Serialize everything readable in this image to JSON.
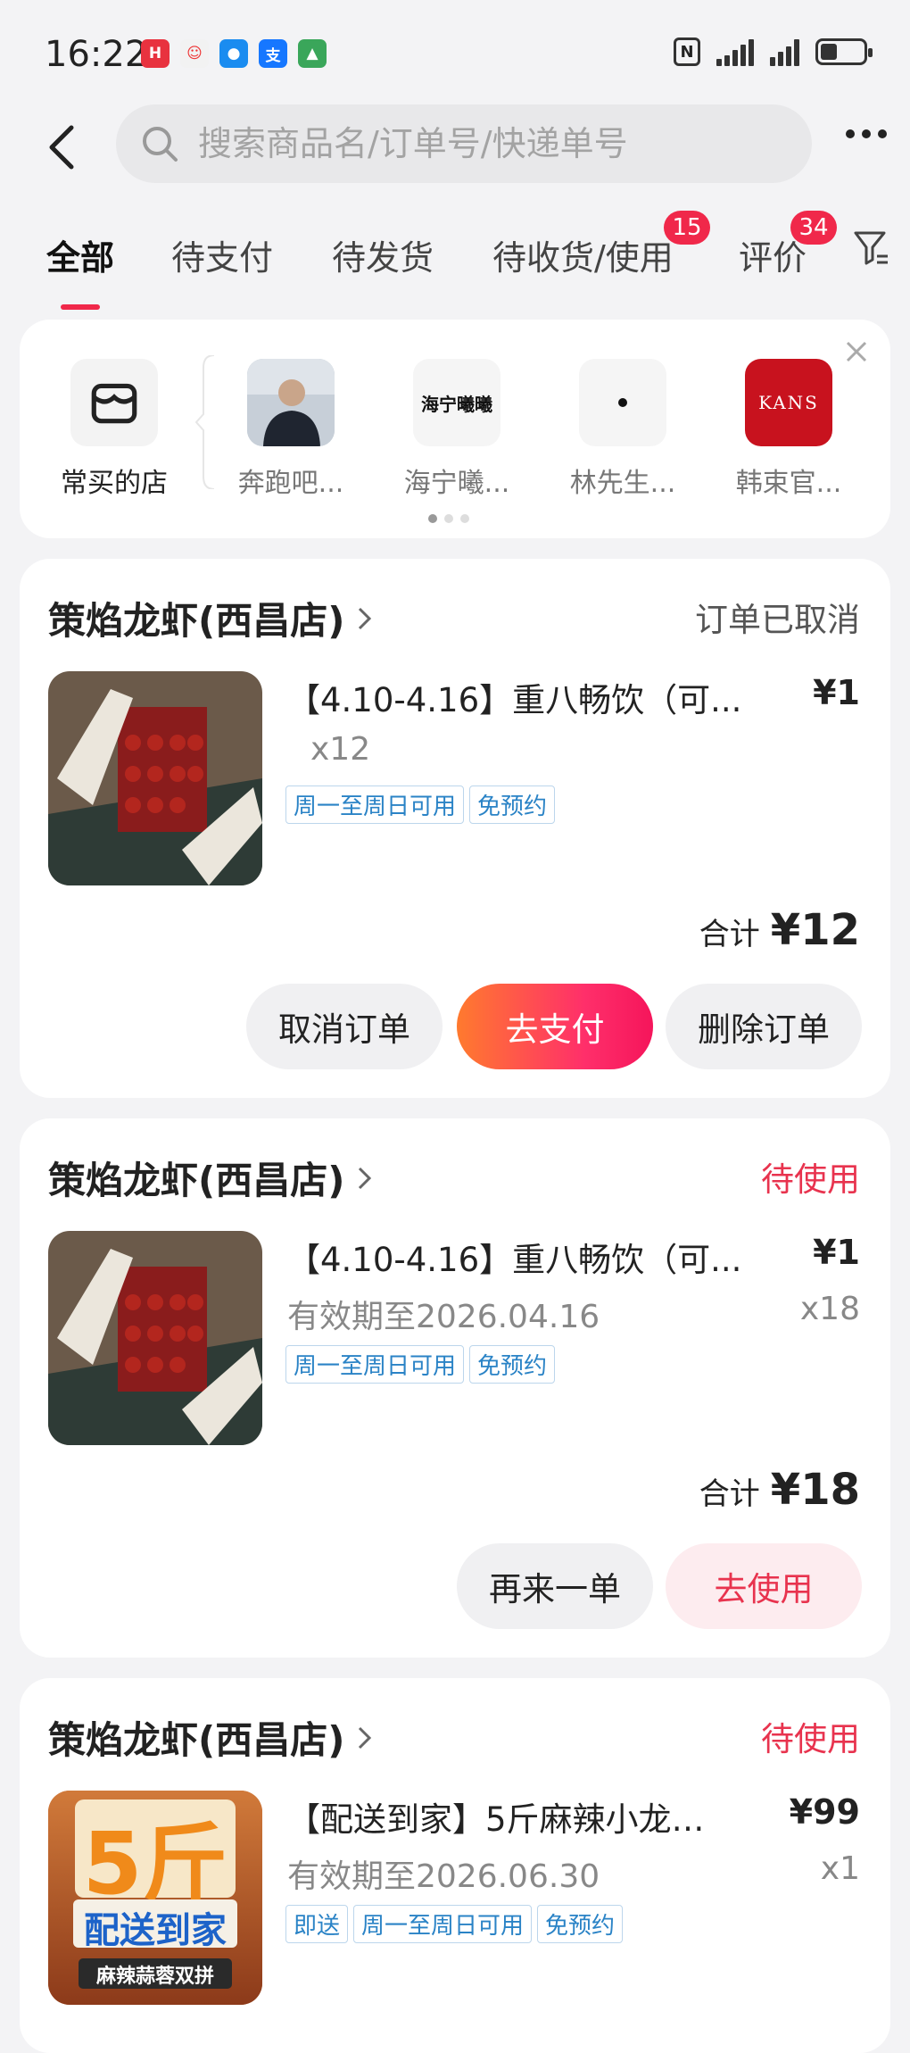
{
  "status_bar": {
    "time": "16:22"
  },
  "search": {
    "placeholder": "搜索商品名/订单号/快递单号"
  },
  "tabs": [
    {
      "label": "全部",
      "active": true
    },
    {
      "label": "待支付"
    },
    {
      "label": "待发货"
    },
    {
      "label": "待收货/使用",
      "badge": "15"
    },
    {
      "label": "评价",
      "badge": "34"
    }
  ],
  "stores": {
    "items": [
      {
        "name": "常买的店"
      },
      {
        "name": "奔跑吧..."
      },
      {
        "name": "海宁曦..."
      },
      {
        "name": "林先生..."
      },
      {
        "name": "韩束官..."
      }
    ],
    "logos": {
      "haining": "海宁曦曦",
      "kans": "KANS"
    }
  },
  "orders": [
    {
      "shop": "策焰龙虾(西昌店)",
      "status": "订单已取消",
      "product": "【4.10-4.16】重八畅饮（可...",
      "price": "¥1",
      "quantity": "x12",
      "validity": "",
      "tags": [
        "周一至周日可用",
        "免预约"
      ],
      "total_label": "合计",
      "total": "¥12",
      "buttons": [
        "取消订单",
        "去支付",
        "删除订单"
      ]
    },
    {
      "shop": "策焰龙虾(西昌店)",
      "status": "待使用",
      "product": "【4.10-4.16】重八畅饮（可...",
      "price": "¥1",
      "quantity": "x18",
      "validity": "有效期至2026.04.16",
      "tags": [
        "周一至周日可用",
        "免预约"
      ],
      "total_label": "合计",
      "total": "¥18",
      "buttons": [
        "再来一单",
        "去使用"
      ]
    },
    {
      "shop": "策焰龙虾(西昌店)",
      "status": "待使用",
      "product": "【配送到家】5斤麻辣小龙虾...",
      "price": "¥99",
      "quantity": "x1",
      "validity": "有效期至2026.06.30",
      "tags": [
        "即送",
        "周一至周日可用",
        "免预约"
      ],
      "thumb_text": {
        "big": "5斤",
        "mid": "配送到家",
        "small": "麻辣蒜蓉双拼"
      }
    }
  ],
  "colors": {
    "accent": "#f0284a",
    "link_tag": "#2a83c6",
    "pending": "#e8334e"
  }
}
